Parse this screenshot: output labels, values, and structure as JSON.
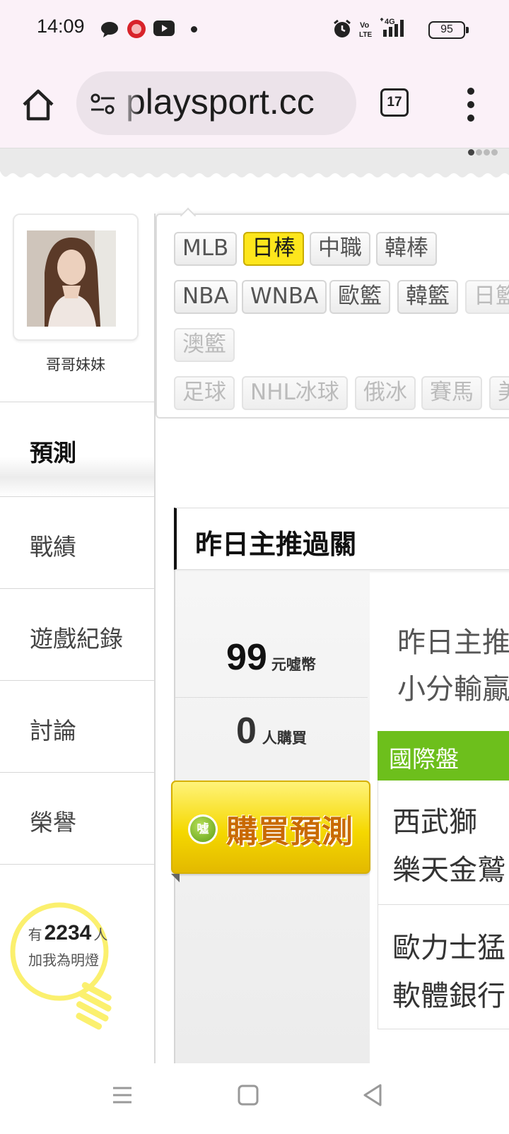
{
  "status_bar": {
    "time": "14:09",
    "battery": "95",
    "icons": [
      "chat-bubble-icon",
      "app-notification-icon",
      "youtube-icon",
      "dot-icon",
      "alarm-icon",
      "volte-icon",
      "4g-signal-icon",
      "battery-icon"
    ]
  },
  "browser": {
    "url": "playsport.cc",
    "tab_count": "17"
  },
  "profile": {
    "username": "哥哥妹妹"
  },
  "sidebar": {
    "items": [
      {
        "label": "預測"
      },
      {
        "label": "戰績"
      },
      {
        "label": "遊戲紀錄"
      },
      {
        "label": "討論"
      },
      {
        "label": "榮譽"
      }
    ],
    "fans_prefix": "有",
    "fans_count": "2234",
    "fans_suffix": "人",
    "fans_caption": "加我為明燈"
  },
  "tags": [
    {
      "label": "MLB"
    },
    {
      "label": "日棒"
    },
    {
      "label": "中職"
    },
    {
      "label": "韓棒"
    },
    {
      "label": "NBA"
    },
    {
      "label": "WNBA"
    },
    {
      "label": "歐籃"
    },
    {
      "label": "韓籃"
    },
    {
      "label": "日籃"
    },
    {
      "label": "澳籃"
    },
    {
      "label": "足球"
    },
    {
      "label": "NHL冰球"
    },
    {
      "label": "俄冰"
    },
    {
      "label": "賽馬"
    },
    {
      "label": "美"
    }
  ],
  "section": {
    "title": "昨日主推過關"
  },
  "purchase": {
    "price": "99",
    "price_unit": "元噓幣",
    "buyers": "0",
    "buyers_unit": "人購買",
    "coin_label": "噓",
    "button_label": "購買預測"
  },
  "pick": {
    "line1": "昨日主推",
    "line2": "小分輸贏",
    "market": "國際盤",
    "matches": [
      {
        "team1": "西武獅",
        "team2": "樂天金鷲"
      },
      {
        "team1": "歐力士猛",
        "team2": "軟體銀行"
      }
    ]
  },
  "colors": {
    "selected_tag": "#fee61c",
    "market_bar": "#6dbf1c",
    "buy_button": "#f5d800"
  }
}
